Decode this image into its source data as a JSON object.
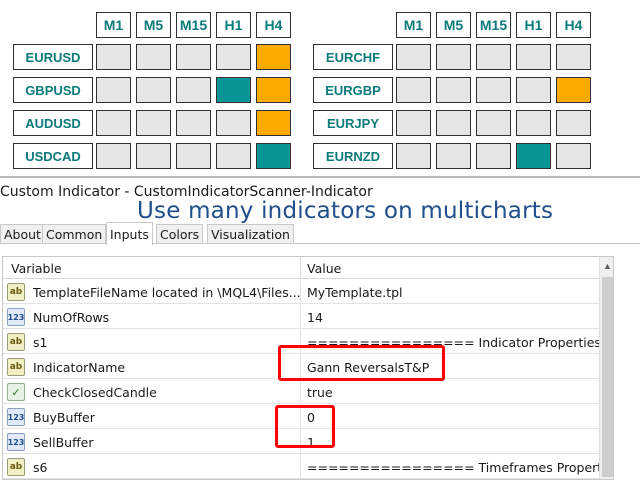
{
  "scanner": {
    "timeframes": [
      "M1",
      "M5",
      "M15",
      "H1",
      "H4"
    ],
    "left": [
      {
        "symbol": "EURUSD",
        "cells": [
          "gray",
          "gray",
          "gray",
          "gray",
          "orange"
        ]
      },
      {
        "symbol": "GBPUSD",
        "cells": [
          "gray",
          "gray",
          "gray",
          "teal",
          "orange"
        ]
      },
      {
        "symbol": "AUDUSD",
        "cells": [
          "gray",
          "gray",
          "gray",
          "gray",
          "orange"
        ]
      },
      {
        "symbol": "USDCAD",
        "cells": [
          "gray",
          "gray",
          "gray",
          "gray",
          "teal"
        ]
      }
    ],
    "right": [
      {
        "symbol": "EURCHF",
        "cells": [
          "gray",
          "gray",
          "gray",
          "gray",
          "gray"
        ]
      },
      {
        "symbol": "EURGBP",
        "cells": [
          "gray",
          "gray",
          "gray",
          "gray",
          "orange"
        ]
      },
      {
        "symbol": "EURJPY",
        "cells": [
          "gray",
          "gray",
          "gray",
          "gray",
          "gray"
        ]
      },
      {
        "symbol": "EURNZD",
        "cells": [
          "gray",
          "gray",
          "gray",
          "teal",
          "gray"
        ]
      }
    ],
    "colors": {
      "gray": "#e6e6e6",
      "teal": "#0a9696",
      "orange": "#ffaa00",
      "label": "#0a7a7a"
    }
  },
  "dialog": {
    "title": "Custom Indicator - CustomIndicatorScanner-Indicator",
    "caption": "Use many indicators on multicharts",
    "tabs": [
      "About",
      "Common",
      "Inputs",
      "Colors",
      "Visualization"
    ],
    "active_tab": "Inputs",
    "columns": {
      "variable": "Variable",
      "value": "Value"
    },
    "rows": [
      {
        "icon": "ab",
        "icon_text": "ab",
        "variable": "TemplateFileName located in \\MQL4\\Files...",
        "value": "MyTemplate.tpl"
      },
      {
        "icon": "num",
        "icon_text": "123",
        "variable": "NumOfRows",
        "value": "14"
      },
      {
        "icon": "ab",
        "icon_text": "ab",
        "variable": "s1",
        "value": "================ Indicator Properties ======..."
      },
      {
        "icon": "ab",
        "icon_text": "ab",
        "variable": "IndicatorName",
        "value": "Gann ReversalsT&P"
      },
      {
        "icon": "chk",
        "icon_text": "✓",
        "variable": "CheckClosedCandle",
        "value": "true"
      },
      {
        "icon": "num",
        "icon_text": "123",
        "variable": "BuyBuffer",
        "value": "0"
      },
      {
        "icon": "num",
        "icon_text": "123",
        "variable": "SellBuffer",
        "value": "1"
      },
      {
        "icon": "ab",
        "icon_text": "ab",
        "variable": "s6",
        "value": "================ Timeframes Properties ===..."
      }
    ],
    "highlight_color": "#ff0000"
  }
}
